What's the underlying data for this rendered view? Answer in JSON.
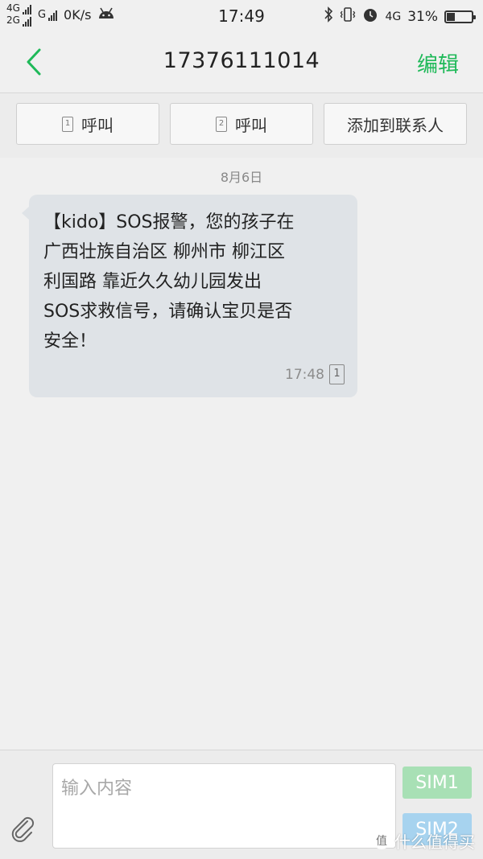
{
  "status_bar": {
    "network_top": "4G",
    "network_bottom": "2G",
    "network_g": "G",
    "speed": "0K/s",
    "android_icon": "android-icon",
    "time": "17:49",
    "bluetooth_icon": "bluetooth-icon",
    "vibrate_icon": "vibrate-icon",
    "alarm_icon": "alarm-icon",
    "network_right": "4G",
    "battery_percent": "31%",
    "battery_level": 0.31
  },
  "header": {
    "back_icon": "chevron-left-icon",
    "title": "17376111014",
    "edit_label": "编辑"
  },
  "actions": {
    "call_sim1": {
      "sim": "1",
      "label": "呼叫"
    },
    "call_sim2": {
      "sim": "2",
      "label": "呼叫"
    },
    "add_contact": {
      "label": "添加到联系人"
    }
  },
  "conversation": {
    "date": "8月6日",
    "message": {
      "lines": [
        "【kido】SOS报警，您的孩子在",
        "广西壮族自治区 柳州市 柳江区",
        "利国路 靠近久久幼儿园发出",
        "SOS求救信号，请确认宝贝是否",
        "安全！"
      ],
      "time": "17:48",
      "sim": "1"
    }
  },
  "composer": {
    "attach_icon": "paperclip-icon",
    "placeholder": "输入内容",
    "sim1_label": "SIM1",
    "sim2_label": "SIM2"
  },
  "watermark": {
    "logo": "值",
    "text": "什么值得买"
  },
  "colors": {
    "accent_green": "#1fb959",
    "sim1_bg": "#a8e0b5",
    "sim2_bg": "#a7d3ef",
    "bubble_bg": "#dfe3e7",
    "background": "#f0f0f0"
  }
}
